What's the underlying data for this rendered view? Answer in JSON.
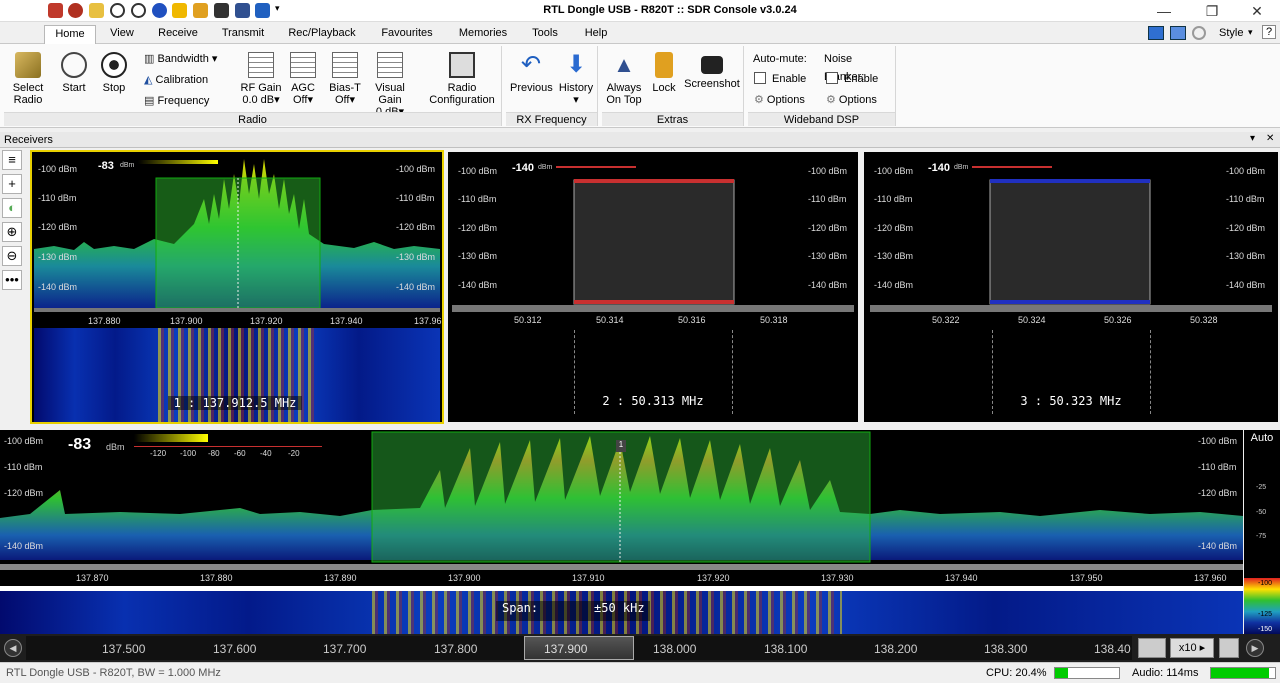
{
  "window": {
    "title": "RTL Dongle USB - R820T :: SDR Console v3.0.24",
    "style_label": "Style"
  },
  "menu": {
    "tabs": [
      "Home",
      "View",
      "Receive",
      "Transmit",
      "Rec/Playback",
      "Favourites",
      "Memories",
      "Tools",
      "Help"
    ]
  },
  "ribbon": {
    "select_radio": "Select Radio",
    "start": "Start",
    "stop": "Stop",
    "bandwidth": "Bandwidth",
    "calibration": "Calibration",
    "frequency": "Frequency",
    "rf_gain": "RF Gain",
    "rf_gain_value": "0.0 dB",
    "agc": "AGC",
    "agc_value": "Off",
    "bias_t": "Bias-T",
    "bias_t_value": "Off",
    "visual_gain": "Visual Gain",
    "visual_gain_value": "0 dB",
    "radio_configuration": "Radio Configuration",
    "radio_group": "Radio",
    "previous": "Previous",
    "history": "History",
    "rx_frequency_group": "RX Frequency",
    "always_on_top": "Always On Top",
    "lock": "Lock",
    "screenshot": "Screenshot",
    "extras_group": "Extras",
    "auto_mute": "Auto-mute:",
    "noise_blanker": "Noise Blanker:",
    "enable": "Enable",
    "options": "Options",
    "wideband_group": "Wideband DSP"
  },
  "receivers_header": "Receivers",
  "receivers": [
    {
      "signal": "-83",
      "dbm_unit": "dBm",
      "dbm_levels": [
        "-100 dBm",
        "-110 dBm",
        "-120 dBm",
        "-130 dBm",
        "-140 dBm"
      ],
      "axis": [
        "137.880",
        "137.900",
        "137.920",
        "137.940",
        "137.96"
      ],
      "freq_label": "1 : 137.912.5 MHz"
    },
    {
      "signal": "-140",
      "dbm_unit": "dBm",
      "dbm_levels": [
        "-100 dBm",
        "-110 dBm",
        "-120 dBm",
        "-130 dBm",
        "-140 dBm"
      ],
      "axis": [
        "50.312",
        "50.314",
        "50.316",
        "50.318"
      ],
      "freq_label": "2 : 50.313 MHz"
    },
    {
      "signal": "-140",
      "dbm_unit": "dBm",
      "dbm_levels": [
        "-100 dBm",
        "-110 dBm",
        "-120 dBm",
        "-130 dBm",
        "-140 dBm"
      ],
      "axis": [
        "50.322",
        "50.324",
        "50.326",
        "50.328"
      ],
      "freq_label": "3 : 50.323 MHz"
    }
  ],
  "main": {
    "signal": "-83",
    "dbm_unit": "dBm",
    "meter_scale": [
      "-120",
      "-100",
      "-80",
      "-60",
      "-40",
      "-20"
    ],
    "dbm_levels": [
      "-100 dBm",
      "-110 dBm",
      "-120 dBm",
      "-140 dBm"
    ],
    "axis": [
      "137.870",
      "137.880",
      "137.890",
      "137.900",
      "137.910",
      "137.920",
      "137.930",
      "137.940",
      "137.950",
      "137.960"
    ],
    "span_label": "Span:",
    "span_value": "±50 kHz",
    "marker": "1",
    "auto_label": "Auto",
    "auto_scale": [
      "-25",
      "-50",
      "-75",
      "-100",
      "-125",
      "-150"
    ],
    "auto_scale_top": "-100",
    "auto_scale_mid": "-125"
  },
  "bottom_axis": {
    "labels": [
      "137.500",
      "137.600",
      "137.700",
      "137.800",
      "137.900",
      "138.000",
      "138.100",
      "138.200",
      "138.300",
      "138.40"
    ],
    "zoom": "x10"
  },
  "status": {
    "left": "RTL Dongle USB - R820T, BW = 1.000 MHz",
    "cpu": "CPU: 20.4%",
    "audio": "Audio: 114ms"
  },
  "meters": {
    "cpu_fraction": 0.2,
    "audio_fraction": 0.9
  },
  "colors": {
    "passband_green": "#2ec23a",
    "rx1_border": "#e8d000",
    "rx2_band": "#c83030",
    "rx3_band": "#2030c0"
  }
}
